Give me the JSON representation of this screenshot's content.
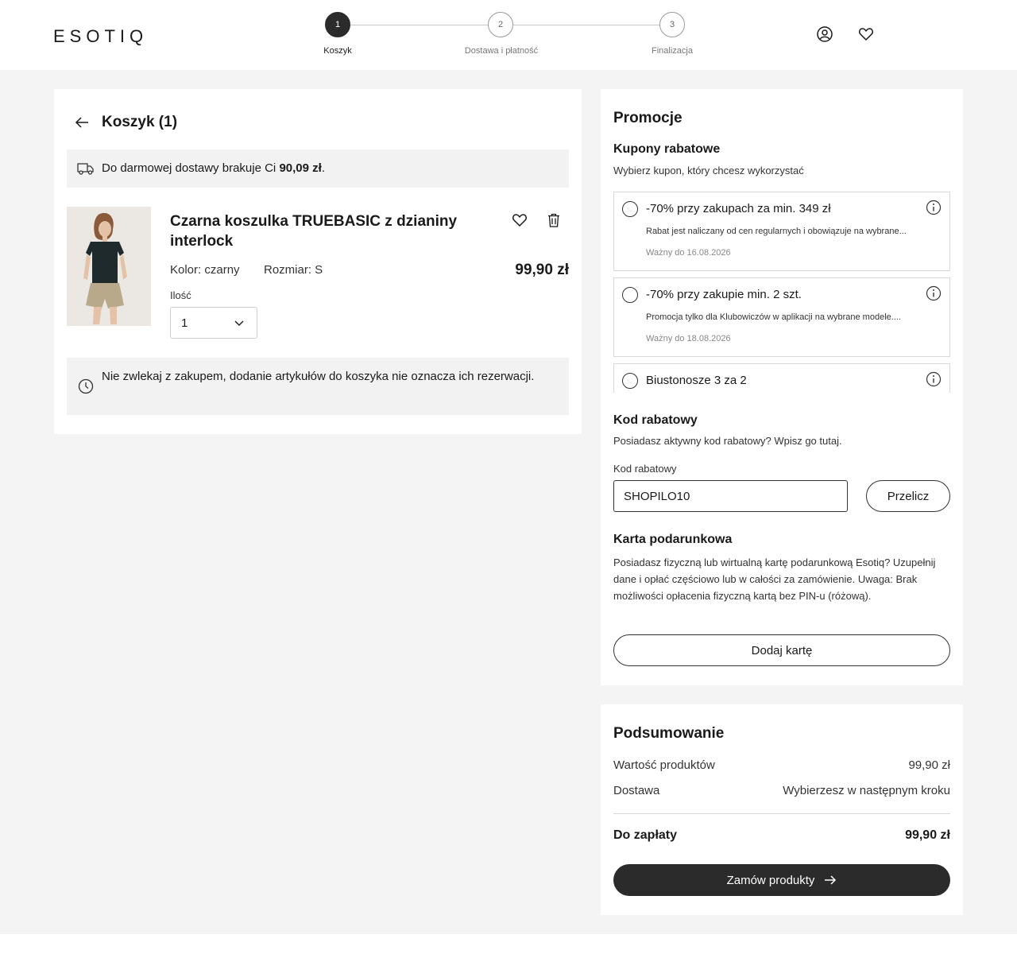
{
  "header": {
    "logo": "ESOTIQ",
    "steps": [
      {
        "number": "1",
        "label": "Koszyk",
        "active": true
      },
      {
        "number": "2",
        "label": "Dostawa i płatność",
        "active": false
      },
      {
        "number": "3",
        "label": "Finalizacja",
        "active": false
      }
    ],
    "icons": [
      "user-icon",
      "heart-icon"
    ]
  },
  "cart": {
    "title": "Koszyk (1)",
    "free_shipping": {
      "text": "Do darmowej dostawy brakuje Ci ",
      "amount": "90,09 zł",
      "suffix": "."
    },
    "item": {
      "name": "Czarna koszulka TRUEBASIC z dzianiny interlock",
      "color": "Kolor: czarny",
      "size": "Rozmiar: S",
      "price": "99,90 zł",
      "quantity_label": "Ilość",
      "quantity": "1"
    },
    "reservation_notice": "Nie zwlekaj z zakupem, dodanie artykułów do koszyka nie oznacza ich rezerwacji."
  },
  "promotions": {
    "title": "Promocje",
    "coupons_title": "Kupony rabatowe",
    "coupons_subtitle": "Wybierz kupon, który chcesz wykorzystać",
    "coupons": [
      {
        "title": "-70% przy zakupach za min. 349 zł",
        "description": "Rabat jest naliczany od cen regularnych i obowiązuje na wybrane...",
        "valid": "Ważny do 16.08.2026"
      },
      {
        "title": "-70% przy zakupie min. 2 szt.",
        "description": "Promocja tylko dla Klubowiczów w aplikacji na wybrane modele....",
        "valid": "Ważny do 18.08.2026"
      },
      {
        "title": "Biustonosze 3 za 2",
        "description": "",
        "valid": ""
      }
    ],
    "code_title": "Kod rabatowy",
    "code_subtitle": "Posiadasz aktywny kod rabatowy? Wpisz go tutaj.",
    "code_label": "Kod rabatowy",
    "code_value": "SHOPILO10",
    "recalc_label": "Przelicz",
    "gift_title": "Karta podarunkowa",
    "gift_description": "Posiadasz fizyczną lub wirtualną kartę podarunkową Esotiq? Uzupełnij dane i opłać częściowo lub w całości za zamówienie. Uwaga: Brak możliwości opłacenia fizyczną kartą bez PIN-u (różową).",
    "add_card_label": "Dodaj kartę"
  },
  "summary": {
    "title": "Podsumowanie",
    "products_label": "Wartość produktów",
    "products_value": "99,90 zł",
    "delivery_label": "Dostawa",
    "delivery_value": "Wybierzesz w następnym kroku",
    "total_label": "Do zapłaty",
    "total_value": "99,90 zł",
    "order_label": "Zamów produkty"
  }
}
